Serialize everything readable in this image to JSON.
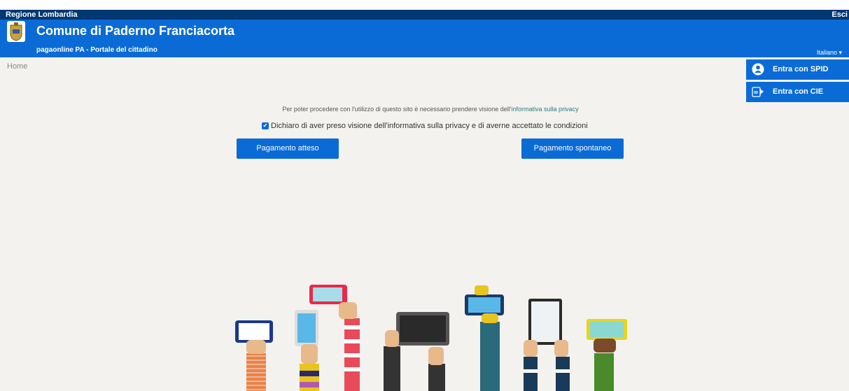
{
  "region": {
    "name": "Regione Lombardia",
    "logout": "Esci"
  },
  "header": {
    "title": "Comune di Paderno Franciacorta",
    "subtitle": "pagaonline PA - Portale del cittadino",
    "language": "Italiano ▾"
  },
  "breadcrumb": {
    "home": "Home"
  },
  "login": {
    "spid": "Entra con SPID",
    "cie": "Entra con CIE"
  },
  "privacy": {
    "text": "Per poter procedere con l'utilizzo di questo sito è necessario prendere visione dell'",
    "link": "informativa sulla privacy",
    "consent_label": "Dichiaro di aver preso visione dell'informativa sulla privacy e di averne accettato le condizioni",
    "checked": true
  },
  "actions": {
    "expected_payment": "Pagamento atteso",
    "spontaneous_payment": "Pagamento spontaneo"
  },
  "colors": {
    "primary": "#0b6bd6",
    "region_bar": "#003872",
    "background": "#f3f2ee"
  }
}
